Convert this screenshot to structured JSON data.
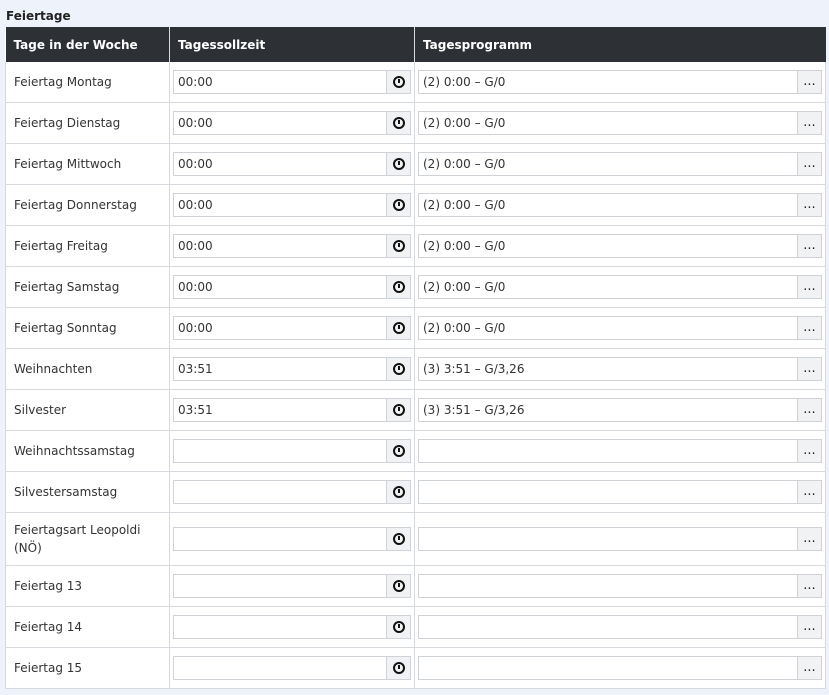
{
  "section": {
    "title": "Feiertage"
  },
  "table": {
    "headers": [
      "Tage in der Woche",
      "Tagessollzeit",
      "Tagesprogramm"
    ],
    "rows": [
      {
        "day": "Feiertag Montag",
        "time": "00:00",
        "program": "(2) 0:00 – G/0"
      },
      {
        "day": "Feiertag Dienstag",
        "time": "00:00",
        "program": "(2) 0:00 – G/0"
      },
      {
        "day": "Feiertag Mittwoch",
        "time": "00:00",
        "program": "(2) 0:00 – G/0"
      },
      {
        "day": "Feiertag Donnerstag",
        "time": "00:00",
        "program": "(2) 0:00 – G/0"
      },
      {
        "day": "Feiertag Freitag",
        "time": "00:00",
        "program": "(2) 0:00 – G/0"
      },
      {
        "day": "Feiertag Samstag",
        "time": "00:00",
        "program": "(2) 0:00 – G/0"
      },
      {
        "day": "Feiertag Sonntag",
        "time": "00:00",
        "program": "(2) 0:00 – G/0"
      },
      {
        "day": "Weihnachten",
        "time": "03:51",
        "program": "(3) 3:51 – G/3,26"
      },
      {
        "day": "Silvester",
        "time": "03:51",
        "program": "(3) 3:51 – G/3,26"
      },
      {
        "day": "Weihnachtssamstag",
        "time": "",
        "program": ""
      },
      {
        "day": "Silvestersamstag",
        "time": "",
        "program": ""
      },
      {
        "day": "Feiertagsart Leopoldi (NÖ)",
        "time": "",
        "program": ""
      },
      {
        "day": "Feiertag 13",
        "time": "",
        "program": ""
      },
      {
        "day": "Feiertag 14",
        "time": "",
        "program": ""
      },
      {
        "day": "Feiertag 15",
        "time": "",
        "program": ""
      }
    ]
  },
  "icons": {
    "time_picker": "clock-icon",
    "program_picker": "ellipsis-icon"
  },
  "picker_label": "..."
}
